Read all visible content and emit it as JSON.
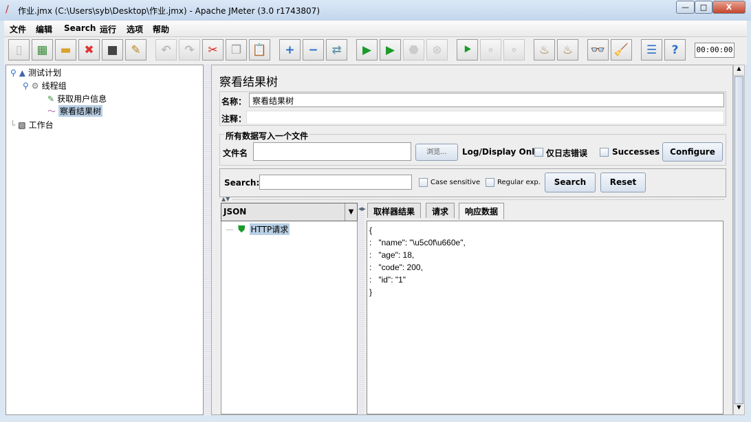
{
  "window": {
    "title": "作业.jmx (C:\\Users\\syb\\Desktop\\作业.jmx) - Apache JMeter (3.0 r1743807)",
    "minimize": "—",
    "maximize": "□",
    "close": "X"
  },
  "menu": [
    "文件",
    "编辑",
    "Search",
    "运行",
    "选项",
    "帮助"
  ],
  "toolbar": {
    "buttons": [
      {
        "icon": "new-icon",
        "glyph": "▯",
        "color": "#bbb",
        "enabled": true
      },
      {
        "icon": "templates-icon",
        "glyph": "▦",
        "color": "#3a8a3a",
        "enabled": true
      },
      {
        "icon": "open-icon",
        "glyph": "▬",
        "color": "#d9a22a",
        "enabled": true
      },
      {
        "icon": "close-file-icon",
        "glyph": "✖",
        "color": "#d33",
        "enabled": true
      },
      {
        "icon": "save-icon",
        "glyph": "■",
        "color": "#444",
        "enabled": true
      },
      {
        "icon": "save-as-icon",
        "glyph": "✎",
        "color": "#b8862b",
        "enabled": true
      },
      {
        "icon": "undo-icon",
        "glyph": "↶",
        "color": "#bbb",
        "enabled": false
      },
      {
        "icon": "redo-icon",
        "glyph": "↷",
        "color": "#bbb",
        "enabled": false
      },
      {
        "icon": "cut-icon",
        "glyph": "✂",
        "color": "#d22",
        "enabled": true
      },
      {
        "icon": "copy-icon",
        "glyph": "❐",
        "color": "#999",
        "enabled": true
      },
      {
        "icon": "paste-icon",
        "glyph": "📋",
        "color": "#a07030",
        "enabled": true
      },
      {
        "icon": "expand-icon",
        "glyph": "+",
        "color": "#2a6fc9",
        "enabled": true
      },
      {
        "icon": "collapse-icon",
        "glyph": "−",
        "color": "#2a6fc9",
        "enabled": true
      },
      {
        "icon": "toggle-icon",
        "glyph": "⇄",
        "color": "#69a",
        "enabled": true
      },
      {
        "icon": "start-icon",
        "glyph": "▶",
        "color": "#1a9a2a",
        "enabled": true
      },
      {
        "icon": "start-no-pauses-icon",
        "glyph": "▶",
        "color": "#1a9a2a",
        "enabled": true
      },
      {
        "icon": "stop-icon",
        "glyph": "⬣",
        "color": "#ccc",
        "enabled": false
      },
      {
        "icon": "shutdown-icon",
        "glyph": "⊗",
        "color": "#ccc",
        "enabled": false
      },
      {
        "icon": "remote-start-icon",
        "glyph": "⯈",
        "color": "#1a9a2a",
        "enabled": true
      },
      {
        "icon": "remote-stop-icon",
        "glyph": "∘",
        "color": "#ccc",
        "enabled": false
      },
      {
        "icon": "remote-shutdown-icon",
        "glyph": "∘",
        "color": "#ccc",
        "enabled": false
      },
      {
        "icon": "clear-icon",
        "glyph": "♨",
        "color": "#a0804a",
        "enabled": true
      },
      {
        "icon": "clear-all-icon",
        "glyph": "♨",
        "color": "#a0804a",
        "enabled": true
      },
      {
        "icon": "search-binoculars-icon",
        "glyph": "👓",
        "color": "#333",
        "enabled": true
      },
      {
        "icon": "reset-search-broom-icon",
        "glyph": "🧹",
        "color": "#e0a020",
        "enabled": true
      },
      {
        "icon": "function-helper-icon",
        "glyph": "☰",
        "color": "#2a6fc9",
        "enabled": true
      },
      {
        "icon": "help-icon",
        "glyph": "?",
        "color": "#2a6fc9",
        "enabled": true
      }
    ],
    "timer": "00:00:00"
  },
  "tree": {
    "items": [
      {
        "label": "测试计划",
        "icon": "test-plan-icon"
      },
      {
        "label": "线程组",
        "icon": "thread-group-gear-icon"
      },
      {
        "label": "获取用户信息",
        "icon": "http-sampler-pipette-icon"
      },
      {
        "label": "察看结果树",
        "icon": "listener-graph-icon",
        "selected": true
      },
      {
        "label": "工作台",
        "icon": "workbench-icon"
      }
    ]
  },
  "panel": {
    "title": "察看结果树",
    "name_label": "名称：",
    "name_value": "察看结果树",
    "comment_label": "注释：",
    "comment_value": "",
    "file_group": "所有数据写入一个文件",
    "filename_label": "文件名",
    "filename_value": "",
    "browse": "浏览...",
    "log_display": "Log/Display Only:",
    "errors_only": "仅日志错误",
    "successes": "Successes",
    "configure": "Configure",
    "search_label": "Search:",
    "search_value": "",
    "case_sensitive": "Case sensitive",
    "regex": "Regular exp.",
    "search_btn": "Search",
    "reset_btn": "Reset",
    "renderer": "JSON",
    "results": [
      {
        "label": "HTTP请求",
        "status": "success"
      }
    ],
    "tabs": [
      "取样器结果",
      "请求",
      "响应数据"
    ],
    "active_tab": 2,
    "response_lines": [
      "{",
      ":   \"name\": \"\\u5c0f\\u660e\",",
      ":   \"age\": 18,",
      ":   \"code\": 200,",
      ":   \"id\": \"1\"",
      "}"
    ]
  }
}
